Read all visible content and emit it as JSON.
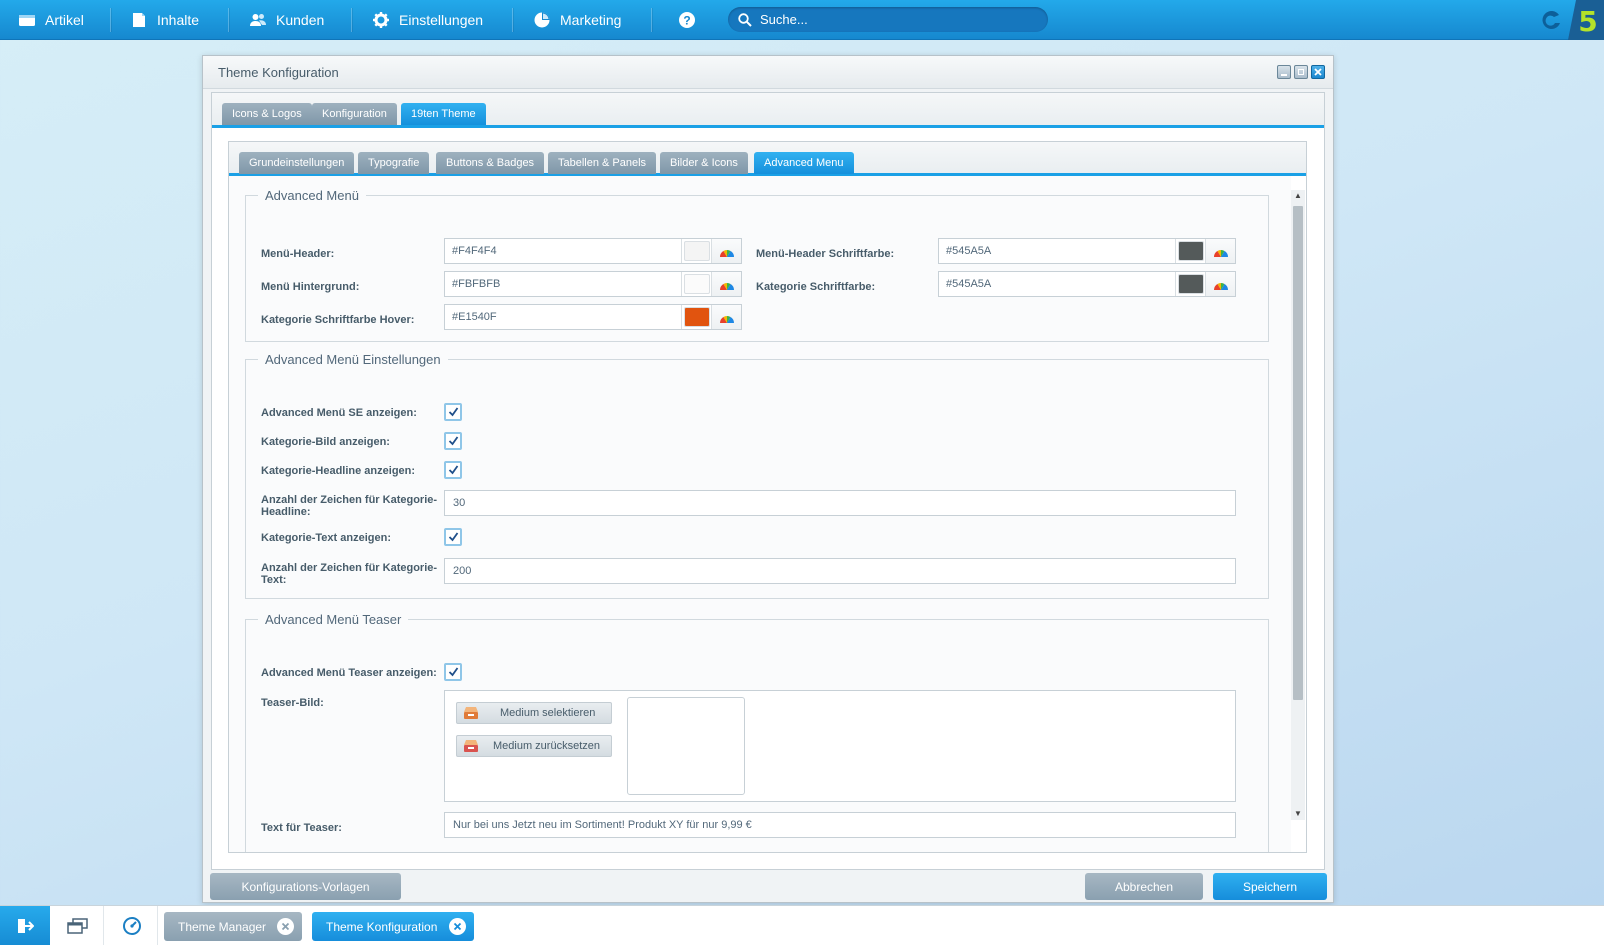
{
  "nav": {
    "items": [
      {
        "label": "Artikel",
        "icon": "article-icon"
      },
      {
        "label": "Inhalte",
        "icon": "content-icon"
      },
      {
        "label": "Kunden",
        "icon": "customers-icon"
      },
      {
        "label": "Einstellungen",
        "icon": "gear-icon"
      },
      {
        "label": "Marketing",
        "icon": "pie-chart-icon"
      }
    ],
    "help_icon": "help-icon",
    "search_placeholder": "Suche..."
  },
  "window": {
    "title": "Theme Konfiguration",
    "tabs": [
      "Icons & Logos",
      "Konfiguration",
      "19ten Theme"
    ],
    "active_tab": "19ten Theme",
    "subtabs": [
      "Grundeinstellungen",
      "Typografie",
      "Buttons & Badges",
      "Tabellen & Panels",
      "Bilder & Icons",
      "Advanced Menu"
    ],
    "active_subtab": "Advanced Menu"
  },
  "advanced_menu": {
    "legend": "Advanced Menü",
    "fields": [
      {
        "label": "Menü-Header:",
        "value": "#F4F4F4",
        "color": "#F4F4F4"
      },
      {
        "label": "Menü Hintergrund:",
        "value": "#FBFBFB",
        "color": "#FBFBFB"
      },
      {
        "label": "Kategorie Schriftfarbe Hover:",
        "value": "#E1540F",
        "color": "#E1540F"
      },
      {
        "label": "Menü-Header Schriftfarbe:",
        "value": "#545A5A",
        "color": "#545A5A"
      },
      {
        "label": "Kategorie Schriftfarbe:",
        "value": "#545A5A",
        "color": "#545A5A"
      }
    ]
  },
  "settings": {
    "legend": "Advanced Menü Einstellungen",
    "se_label": "Advanced Menü SE anzeigen:",
    "image_label": "Kategorie-Bild anzeigen:",
    "headline_label": "Kategorie-Headline anzeigen:",
    "headline_chars_label_1": "Anzahl der Zeichen für Kategorie-",
    "headline_chars_label_2": "Headline:",
    "headline_chars_value": "30",
    "text_label": "Kategorie-Text anzeigen:",
    "text_chars_label_1": "Anzahl der Zeichen für Kategorie-",
    "text_chars_label_2": "Text:",
    "text_chars_value": "200"
  },
  "teaser": {
    "legend": "Advanced Menü Teaser",
    "show_label": "Advanced Menü Teaser anzeigen:",
    "image_label": "Teaser-Bild:",
    "select_button": "Medium selektieren",
    "reset_button": "Medium zurücksetzen",
    "text_label": "Text für Teaser:",
    "text_value": "Nur bei uns Jetzt neu im Sortiment! Produkt XY für nur 9,99 €"
  },
  "footer": {
    "templates_button": "Konfigurations-Vorlagen",
    "cancel_button": "Abbrechen",
    "save_button": "Speichern"
  },
  "taskbar": {
    "tasks": [
      "Theme Manager",
      "Theme Konfiguration"
    ],
    "active_task": "Theme Konfiguration"
  },
  "colors": {
    "accent": "#1A9EE6",
    "nav_top": "#23A9EA",
    "brand_green": "#B4E32A",
    "tab_inactive": "#8AA0B0"
  }
}
